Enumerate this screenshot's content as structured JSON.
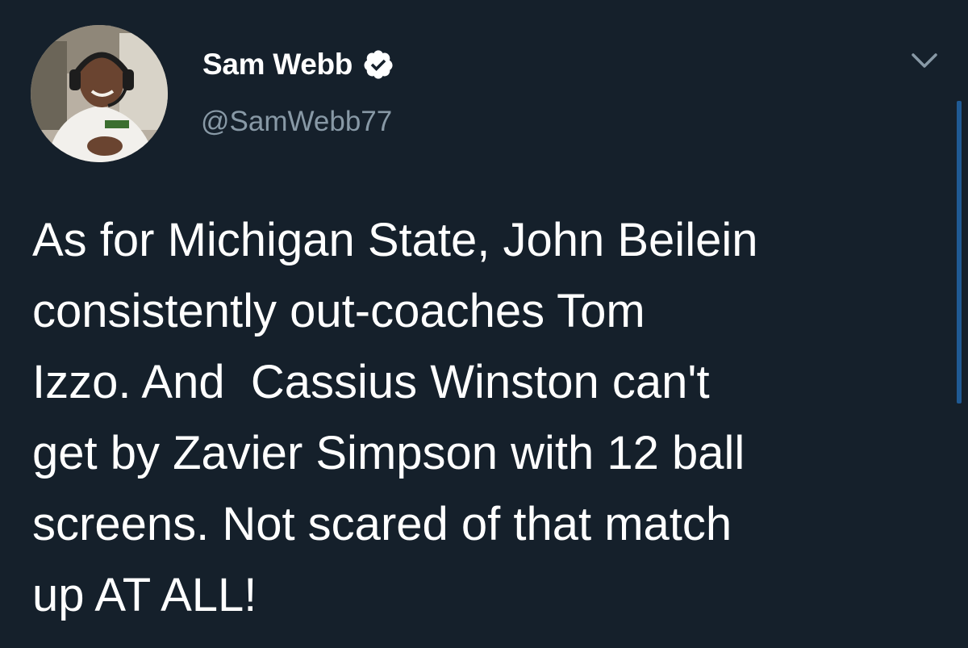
{
  "tweet": {
    "author": {
      "display_name": "Sam Webb",
      "handle": "@SamWebb77",
      "verified": true,
      "avatar_icon": "profile-photo"
    },
    "text": "As for Michigan State, John Beilein\nconsistently out-coaches Tom\nIzzo. And  Cassius Winston can't\nget by Zavier Simpson with 12 ball\nscreens. Not scared of that match\nup AT ALL!",
    "menu_icon": "chevron-down-icon"
  },
  "colors": {
    "background": "#15202b",
    "text_primary": "#ffffff",
    "text_secondary": "#8899a6",
    "verified_badge": "#ffffff",
    "scrollbar": "#1f5a94"
  }
}
